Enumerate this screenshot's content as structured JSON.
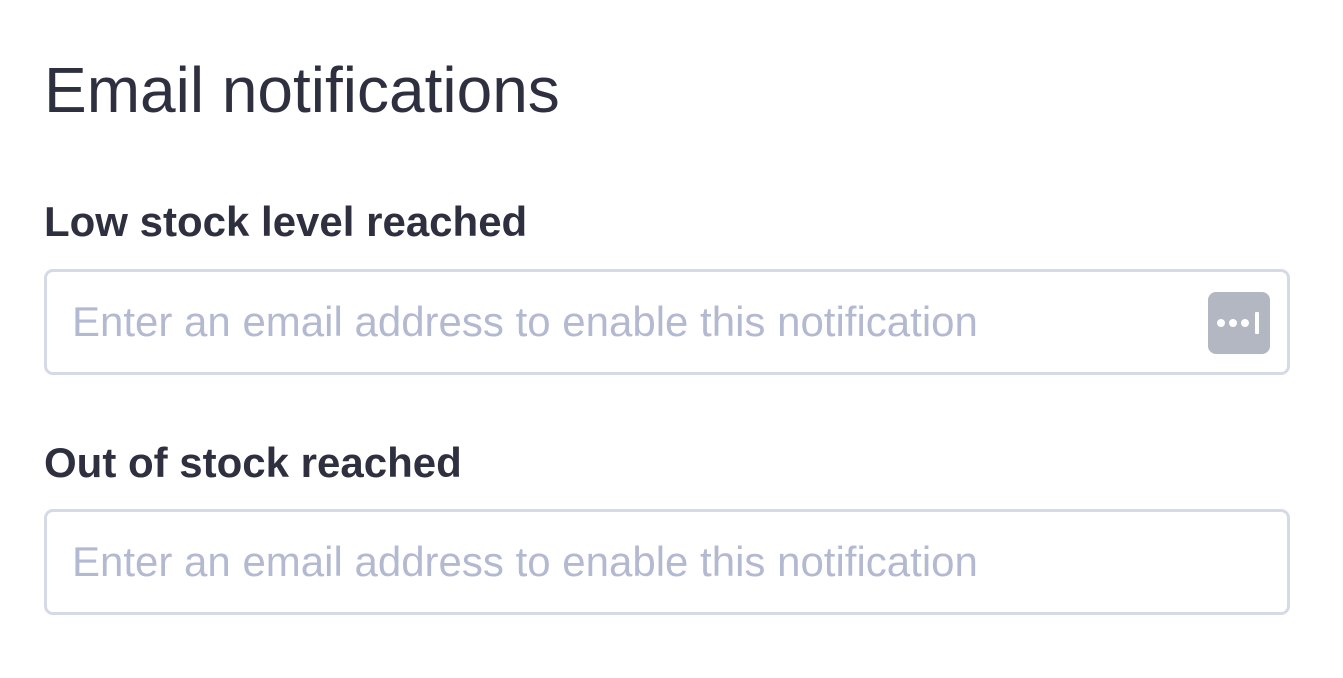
{
  "section": {
    "title": "Email notifications"
  },
  "fields": [
    {
      "label": "Low stock level reached",
      "placeholder": "Enter an email address to enable this notification",
      "value": "",
      "accessory_icon": "password-manager-icon"
    },
    {
      "label": "Out of stock reached",
      "placeholder": "Enter an email address to enable this notification",
      "value": ""
    }
  ],
  "colors": {
    "title_text": "#2e3040",
    "placeholder_text": "#b4b9d2",
    "input_border": "#d6d9e6",
    "icon_background": "#b3b7c1"
  }
}
